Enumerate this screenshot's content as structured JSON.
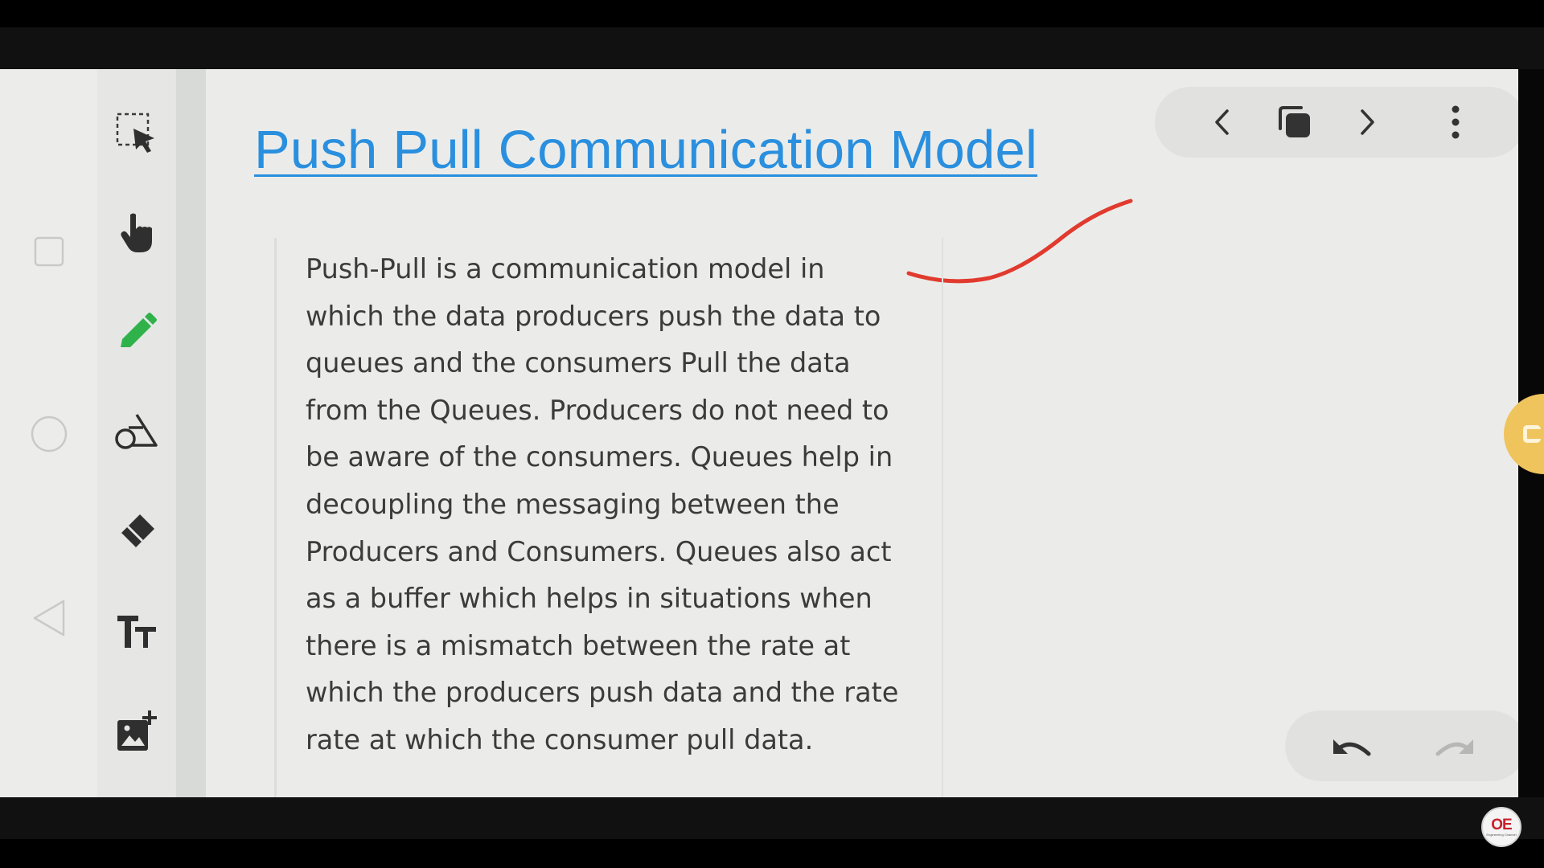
{
  "document": {
    "title": "Push Pull Communication Model",
    "paragraph_lines": [
      "Push-Pull is a communication model in",
      "which the data producers push the data to",
      "queues and the consumers Pull the data",
      "from the Queues. Producers do not need to",
      "be aware of the consumers. Queues help in",
      "decoupling the messaging between the",
      "Producers and Consumers. Queues also act",
      "as a buffer which helps in situations when",
      "there is a mismatch between the rate at",
      "which the producers push data and the rate",
      "rate at which the consumer pull data."
    ]
  },
  "toolbar": {
    "tools": [
      "select-lasso",
      "hand",
      "pen",
      "shapes",
      "eraser",
      "text",
      "add-image"
    ],
    "active_tool": "pen",
    "pen_color": "#2fb24a"
  },
  "page_nav": {
    "icons": [
      "chevron-left",
      "pages",
      "chevron-right",
      "more-vertical"
    ]
  },
  "history": {
    "icons": [
      "undo",
      "redo"
    ]
  },
  "annotation": {
    "ink_color": "#e13a2e"
  },
  "colors": {
    "title": "#2a8fde",
    "fab": "#f0c45d"
  },
  "logo": {
    "mark": "OE",
    "tagline": "Engineering Channel"
  }
}
